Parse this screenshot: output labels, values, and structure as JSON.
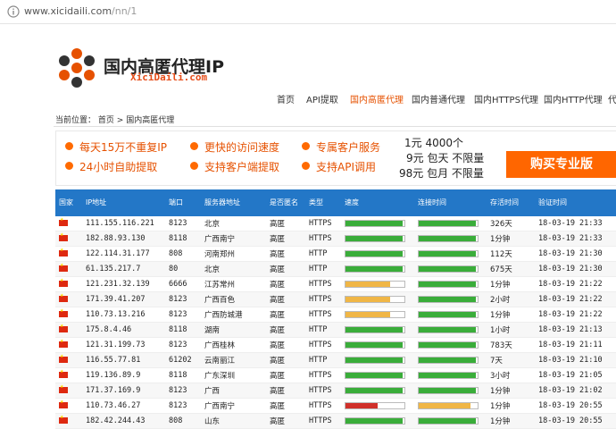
{
  "browser": {
    "url_host": "www.xicidaili.com",
    "url_path": "/nn/1"
  },
  "header": {
    "brand_cn": "国内高匿代理IP",
    "brand_en": "XiciDaili.com"
  },
  "nav": {
    "items": [
      {
        "label": "首页",
        "active": false
      },
      {
        "label": "API提取",
        "active": false
      },
      {
        "label": "国内高匿代理",
        "active": true
      },
      {
        "label": "国内普通代理",
        "active": false
      },
      {
        "label": "国内HTTPS代理",
        "active": false
      },
      {
        "label": "国内HTTP代理",
        "active": false
      },
      {
        "label": "代",
        "active": false
      }
    ]
  },
  "breadcrumb": {
    "prefix": "当前位置：",
    "home": "首页",
    "sep": ">",
    "current": "国内高匿代理"
  },
  "banner": {
    "features": [
      "每天15万不重复IP",
      "更快的访问速度",
      "专属客户服务",
      "24小时自助提取",
      "支持客户端提取",
      "支持API调用"
    ],
    "prices": [
      "1元 4000个",
      "9元 包天 不限量",
      "98元 包月 不限量"
    ],
    "buy_label": "购买专业版",
    "accent": "#ff6600"
  },
  "table": {
    "headers": [
      "国家",
      "IP地址",
      "端口",
      "服务器地址",
      "是否匿名",
      "类型",
      "速度",
      "连接时间",
      "存活时间",
      "验证时间"
    ],
    "rows": [
      {
        "ip": "111.155.116.221",
        "port": "8123",
        "location": "北京",
        "anon": "高匿",
        "type": "HTTPS",
        "speed": 0.97,
        "speed_level": "fast",
        "conn": 0.97,
        "conn_level": "fast",
        "alive": "326天",
        "verified": "18-03-19 21:33"
      },
      {
        "ip": "182.88.93.130",
        "port": "8118",
        "location": "广西南宁",
        "anon": "高匿",
        "type": "HTTPS",
        "speed": 0.97,
        "speed_level": "fast",
        "conn": 0.97,
        "conn_level": "fast",
        "alive": "1分钟",
        "verified": "18-03-19 21:33"
      },
      {
        "ip": "122.114.31.177",
        "port": "808",
        "location": "河南郑州",
        "anon": "高匿",
        "type": "HTTP",
        "speed": 0.97,
        "speed_level": "fast",
        "conn": 0.97,
        "conn_level": "fast",
        "alive": "112天",
        "verified": "18-03-19 21:30"
      },
      {
        "ip": "61.135.217.7",
        "port": "80",
        "location": "北京",
        "anon": "高匿",
        "type": "HTTP",
        "speed": 0.97,
        "speed_level": "fast",
        "conn": 0.97,
        "conn_level": "fast",
        "alive": "675天",
        "verified": "18-03-19 21:30"
      },
      {
        "ip": "121.231.32.139",
        "port": "6666",
        "location": "江苏常州",
        "anon": "高匿",
        "type": "HTTPS",
        "speed": 0.75,
        "speed_level": "mid",
        "conn": 0.97,
        "conn_level": "fast",
        "alive": "1分钟",
        "verified": "18-03-19 21:22"
      },
      {
        "ip": "171.39.41.207",
        "port": "8123",
        "location": "广西百色",
        "anon": "高匿",
        "type": "HTTPS",
        "speed": 0.75,
        "speed_level": "mid",
        "conn": 0.97,
        "conn_level": "fast",
        "alive": "2小时",
        "verified": "18-03-19 21:22"
      },
      {
        "ip": "110.73.13.216",
        "port": "8123",
        "location": "广西防城港",
        "anon": "高匿",
        "type": "HTTPS",
        "speed": 0.75,
        "speed_level": "mid",
        "conn": 0.97,
        "conn_level": "fast",
        "alive": "1分钟",
        "verified": "18-03-19 21:22"
      },
      {
        "ip": "175.8.4.46",
        "port": "8118",
        "location": "湖南",
        "anon": "高匿",
        "type": "HTTP",
        "speed": 0.97,
        "speed_level": "fast",
        "conn": 0.97,
        "conn_level": "fast",
        "alive": "1小时",
        "verified": "18-03-19 21:13"
      },
      {
        "ip": "121.31.199.73",
        "port": "8123",
        "location": "广西桂林",
        "anon": "高匿",
        "type": "HTTPS",
        "speed": 0.97,
        "speed_level": "fast",
        "conn": 0.97,
        "conn_level": "fast",
        "alive": "783天",
        "verified": "18-03-19 21:11"
      },
      {
        "ip": "116.55.77.81",
        "port": "61202",
        "location": "云南丽江",
        "anon": "高匿",
        "type": "HTTP",
        "speed": 0.97,
        "speed_level": "fast",
        "conn": 0.97,
        "conn_level": "fast",
        "alive": "7天",
        "verified": "18-03-19 21:10"
      },
      {
        "ip": "119.136.89.9",
        "port": "8118",
        "location": "广东深圳",
        "anon": "高匿",
        "type": "HTTPS",
        "speed": 0.97,
        "speed_level": "fast",
        "conn": 0.97,
        "conn_level": "fast",
        "alive": "3小时",
        "verified": "18-03-19 21:05"
      },
      {
        "ip": "171.37.169.9",
        "port": "8123",
        "location": "广西",
        "anon": "高匿",
        "type": "HTTPS",
        "speed": 0.97,
        "speed_level": "fast",
        "conn": 0.97,
        "conn_level": "fast",
        "alive": "1分钟",
        "verified": "18-03-19 21:02"
      },
      {
        "ip": "110.73.46.27",
        "port": "8123",
        "location": "广西南宁",
        "anon": "高匿",
        "type": "HTTPS",
        "speed": 0.55,
        "speed_level": "slow",
        "conn": 0.88,
        "conn_level": "mid",
        "alive": "1分钟",
        "verified": "18-03-19 20:55"
      },
      {
        "ip": "182.42.244.43",
        "port": "808",
        "location": "山东",
        "anon": "高匿",
        "type": "HTTPS",
        "speed": 0.97,
        "speed_level": "fast",
        "conn": 0.97,
        "conn_level": "fast",
        "alive": "1分钟",
        "verified": "18-03-19 20:55"
      }
    ]
  }
}
